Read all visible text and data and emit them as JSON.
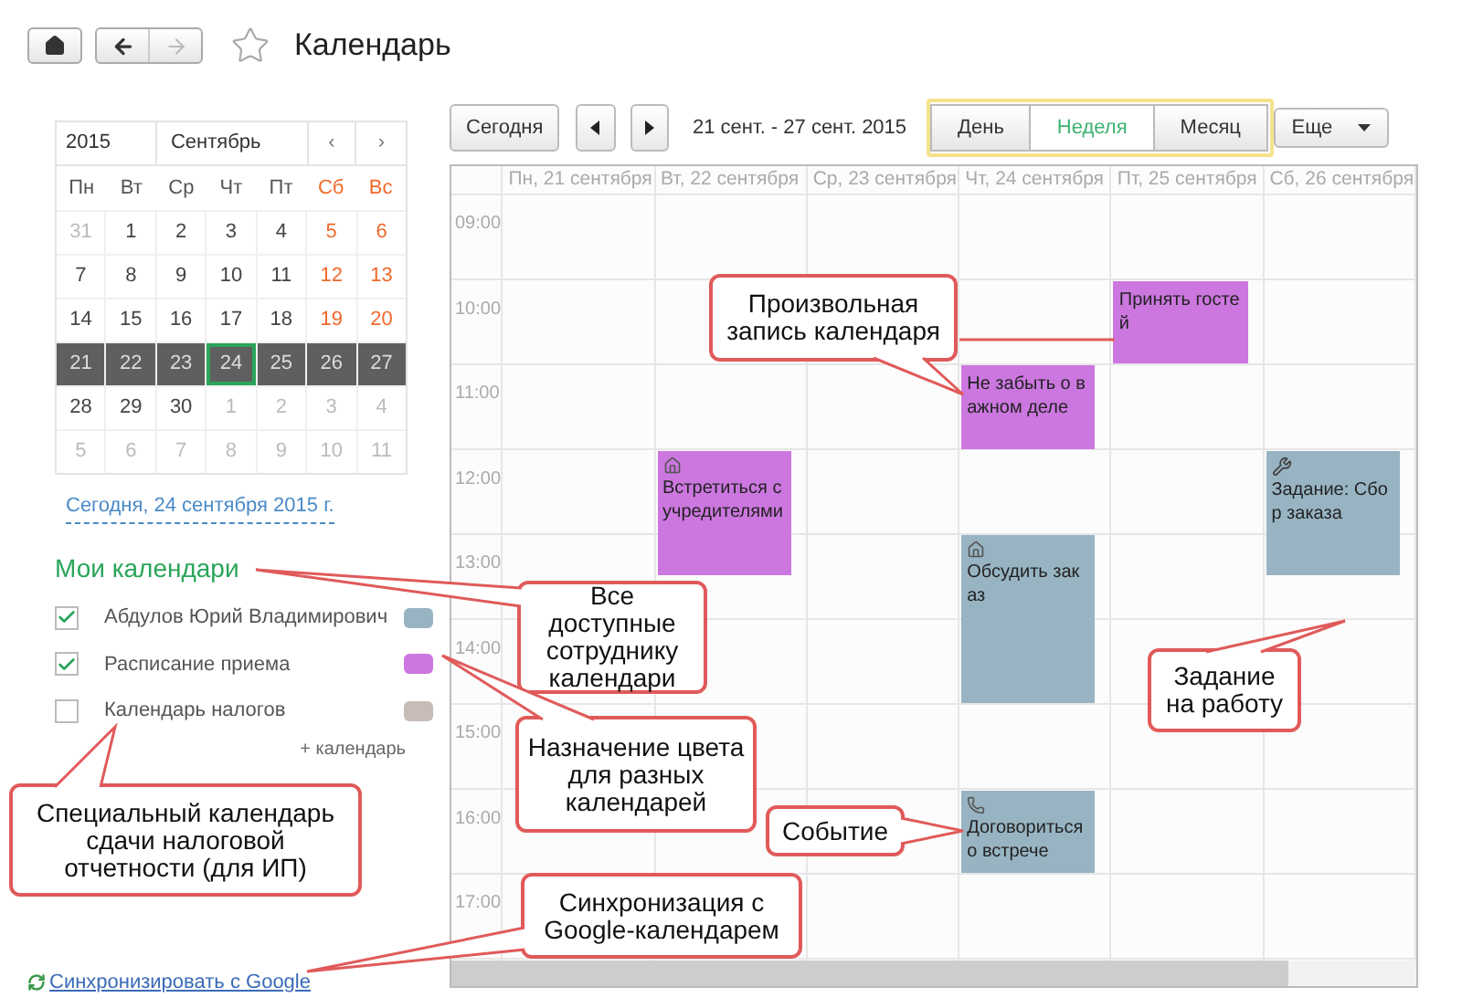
{
  "header": {
    "forward_disabled": true,
    "title": "Календарь"
  },
  "mini_calendar": {
    "year": "2015",
    "month": "Сентябрь",
    "prev": "‹",
    "next": "›",
    "weekdays": [
      {
        "label": "Пн",
        "weekend": false
      },
      {
        "label": "Вт",
        "weekend": false
      },
      {
        "label": "Ср",
        "weekend": false
      },
      {
        "label": "Чт",
        "weekend": false
      },
      {
        "label": "Пт",
        "weekend": false
      },
      {
        "label": "Сб",
        "weekend": true
      },
      {
        "label": "Вс",
        "weekend": true
      }
    ],
    "weeks": [
      {
        "selected": false,
        "days": [
          {
            "day": "31",
            "kind": "other_month",
            "today": false
          },
          {
            "day": "1",
            "kind": "weekday",
            "today": false
          },
          {
            "day": "2",
            "kind": "weekday",
            "today": false
          },
          {
            "day": "3",
            "kind": "weekday",
            "today": false
          },
          {
            "day": "4",
            "kind": "weekday",
            "today": false
          },
          {
            "day": "5",
            "kind": "weekend",
            "today": false
          },
          {
            "day": "6",
            "kind": "weekend",
            "today": false
          }
        ]
      },
      {
        "selected": false,
        "days": [
          {
            "day": "7",
            "kind": "weekday",
            "today": false
          },
          {
            "day": "8",
            "kind": "weekday",
            "today": false
          },
          {
            "day": "9",
            "kind": "weekday",
            "today": false
          },
          {
            "day": "10",
            "kind": "weekday",
            "today": false
          },
          {
            "day": "11",
            "kind": "weekday",
            "today": false
          },
          {
            "day": "12",
            "kind": "weekend",
            "today": false
          },
          {
            "day": "13",
            "kind": "weekend",
            "today": false
          }
        ]
      },
      {
        "selected": false,
        "days": [
          {
            "day": "14",
            "kind": "weekday",
            "today": false
          },
          {
            "day": "15",
            "kind": "weekday",
            "today": false
          },
          {
            "day": "16",
            "kind": "weekday",
            "today": false
          },
          {
            "day": "17",
            "kind": "weekday",
            "today": false
          },
          {
            "day": "18",
            "kind": "weekday",
            "today": false
          },
          {
            "day": "19",
            "kind": "weekend",
            "today": false
          },
          {
            "day": "20",
            "kind": "weekend",
            "today": false
          }
        ]
      },
      {
        "selected": true,
        "days": [
          {
            "day": "21",
            "today": false
          },
          {
            "day": "22",
            "today": false
          },
          {
            "day": "23",
            "today": false
          },
          {
            "day": "24",
            "today": true
          },
          {
            "day": "25",
            "today": false
          },
          {
            "day": "26",
            "today": false
          },
          {
            "day": "27",
            "today": false
          }
        ]
      },
      {
        "selected": false,
        "days": [
          {
            "day": "28",
            "kind": "weekday",
            "today": false
          },
          {
            "day": "29",
            "kind": "weekday",
            "today": false
          },
          {
            "day": "30",
            "kind": "weekday",
            "today": false
          },
          {
            "day": "1",
            "kind": "other_month",
            "today": false
          },
          {
            "day": "2",
            "kind": "other_month",
            "today": false
          },
          {
            "day": "3",
            "kind": "other_month",
            "today": false
          },
          {
            "day": "4",
            "kind": "other_month",
            "today": false
          }
        ]
      },
      {
        "selected": false,
        "days": [
          {
            "day": "5",
            "kind": "other_month",
            "today": false
          },
          {
            "day": "6",
            "kind": "other_month",
            "today": false
          },
          {
            "day": "7",
            "kind": "other_month",
            "today": false
          },
          {
            "day": "8",
            "kind": "other_month",
            "today": false
          },
          {
            "day": "9",
            "kind": "other_month",
            "today": false
          },
          {
            "day": "10",
            "kind": "other_month",
            "today": false
          },
          {
            "day": "11",
            "kind": "other_month",
            "today": false
          }
        ]
      }
    ]
  },
  "today_link": "Сегодня, 24 сентября 2015 г.",
  "my_calendars": {
    "title": "Мои календари",
    "items": [
      {
        "label": "Абдулов Юрий Владимирович",
        "checked": true,
        "color": "#98b4c2"
      },
      {
        "label": "Расписание приема",
        "checked": true,
        "color": "#cc77e0"
      },
      {
        "label": "Календарь налогов",
        "checked": false,
        "color": "#c8bcb8"
      }
    ],
    "add": "+ календарь"
  },
  "sync_link": "Синхронизировать с Google",
  "toolbar": {
    "today_button": "Сегодня",
    "period": "21 сент. - 27 сент. 2015",
    "views": [
      {
        "label": "День",
        "selected": false
      },
      {
        "label": "Неделя",
        "selected": true
      },
      {
        "label": "Месяц",
        "selected": false
      }
    ],
    "more_button": "Еще"
  },
  "week": {
    "days": [
      "Пн, 21 сентября",
      "Вт, 22 сентября",
      "Ср, 23 сентября",
      "Чт, 24 сентября",
      "Пт, 25 сентября",
      "Сб, 26 сентября"
    ],
    "hours": [
      "09:00",
      "10:00",
      "11:00",
      "12:00",
      "13:00",
      "14:00",
      "15:00",
      "16:00",
      "17:00"
    ],
    "events": [
      {
        "text": "Принять гостей",
        "kind": "note",
        "color": "#cc77e0"
      },
      {
        "text": "Не забыть о важном деле",
        "kind": "note",
        "color": "#cc77e0"
      },
      {
        "text": "Встретиться с учредителями",
        "kind": "meeting",
        "color": "#cc77e0"
      },
      {
        "text": "Задание: Сбор заказа",
        "kind": "task",
        "color": "#98b4c2"
      },
      {
        "text": "Обсудить заказ",
        "kind": "meeting",
        "color": "#98b4c2"
      },
      {
        "text": "Договориться о встрече",
        "kind": "call",
        "color": "#98b4c2"
      }
    ]
  },
  "callouts": [
    {
      "text": "Все доступные сотруднику календари"
    },
    {
      "text": "Произвольная запись календаря"
    },
    {
      "text": "Назначение цвета для разных календарей"
    },
    {
      "text": "Задание на работу"
    },
    {
      "text": "Событие"
    },
    {
      "text": "Специальный календарь сдачи налоговой отчетности (для ИП)"
    },
    {
      "text": "Синхронизация с Google-календарем"
    }
  ]
}
